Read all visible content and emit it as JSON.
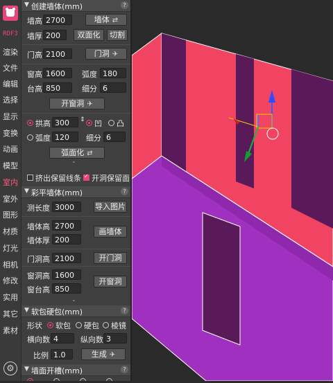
{
  "sidebar": {
    "tag": "RDF3",
    "items": [
      "渲染",
      "文件",
      "编辑",
      "选择",
      "显示",
      "变换",
      "动画",
      "模型",
      "室内",
      "室外",
      "图形",
      "材质",
      "灯光",
      "相机",
      "修改",
      "实用",
      "其它",
      "素材"
    ],
    "active": "室内"
  },
  "wall": {
    "title": "创建墙体(mm)",
    "height_label": "墙高",
    "height": "2700",
    "wall_button": "墙体",
    "thickness_label": "墙厚",
    "thickness": "200",
    "double_button": "双面化",
    "cut_button": "切割",
    "door_h_label": "门高",
    "door_h": "2100",
    "door_button": "门洞",
    "win_h_label": "窗高",
    "win_h": "1600",
    "arc_label": "弧度",
    "arc": "180",
    "sill_label": "台高",
    "sill": "850",
    "div_label": "细分",
    "div": "6",
    "open_win_button": "开窗洞",
    "arch_label": "拱高",
    "arch": "300",
    "concave_label": "凹",
    "convex_label": "凸",
    "arc2_label": "弧度",
    "arc2": "120",
    "div2_label": "细分",
    "div2": "6",
    "arcify_button": "弧面化",
    "keep_lines_label": "挤出保留线条",
    "keep_face_label": "开洞保留面"
  },
  "color_wall": {
    "title": "彩平墙体(mm)",
    "measure_label": "测长度",
    "measure": "3000",
    "import_button": "导入图片",
    "h_label": "墙体高",
    "h": "2700",
    "t_label": "墙体厚",
    "t": "200",
    "draw_button": "画墙体",
    "door_label": "门洞高",
    "door": "2100",
    "door_button": "开门洞",
    "win_label": "窗洞高",
    "win": "1600",
    "sill_label": "窗台高",
    "sill": "850",
    "win_button": "开窗洞"
  },
  "soft": {
    "title": "软包硬包(mm)",
    "shape_label": "形状",
    "soft_label": "软包",
    "hard_label": "硬包",
    "mirror_label": "棱镜",
    "hcount_label": "横向数",
    "hcount": "4",
    "vcount_label": "纵向数",
    "vcount": "3",
    "ratio_label": "比例",
    "ratio": "1.0",
    "gen_button": "生成"
  },
  "groove": {
    "title": "墙面开槽(mm)"
  }
}
